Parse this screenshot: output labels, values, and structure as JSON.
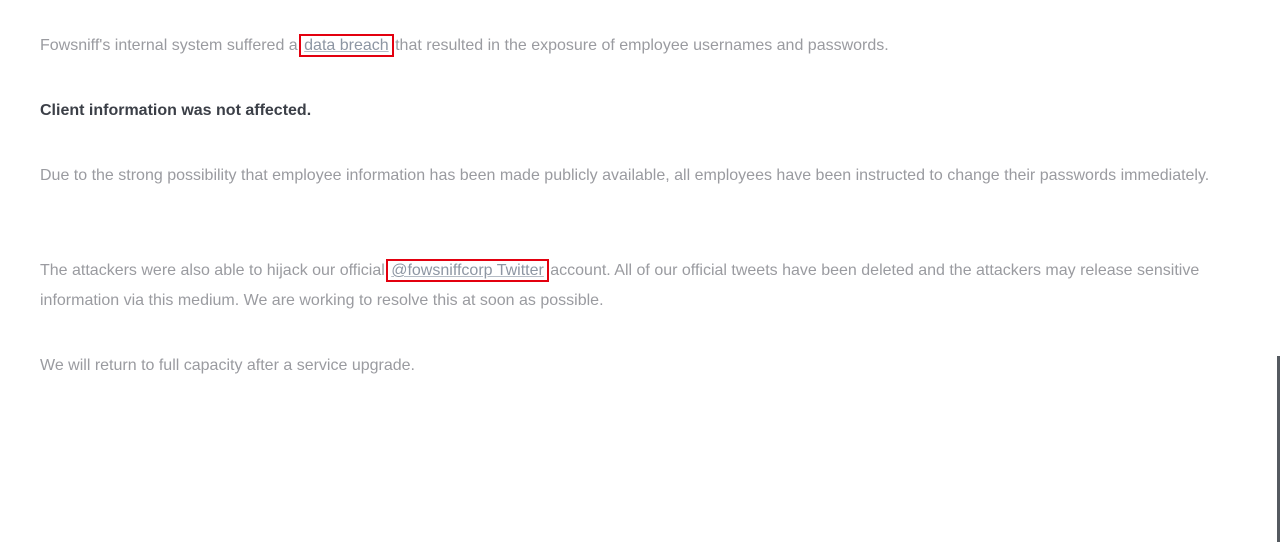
{
  "article": {
    "p1": {
      "before": "Fowsniff's internal system suffered a ",
      "link": "data breach",
      "after": " that resulted in the exposure of employee usernames and passwords."
    },
    "p2": "Client information was not affected.",
    "p3": "Due to the strong possibility that employee information has been made publicly available, all employees have been instructed to change their passwords immediately.",
    "p4": {
      "before": "The attackers were also able to hijack our official ",
      "link": "@fowsniffcorp Twitter",
      "after": " account. All of our official tweets have been deleted and the attackers may release sensitive information via this medium. We are working to resolve this at soon as possible."
    },
    "p5": "We will return to full capacity after a service upgrade."
  },
  "colors": {
    "body_text": "#9a9ba0",
    "bold_text": "#3b3f47",
    "highlight_box": "#e3000f"
  }
}
